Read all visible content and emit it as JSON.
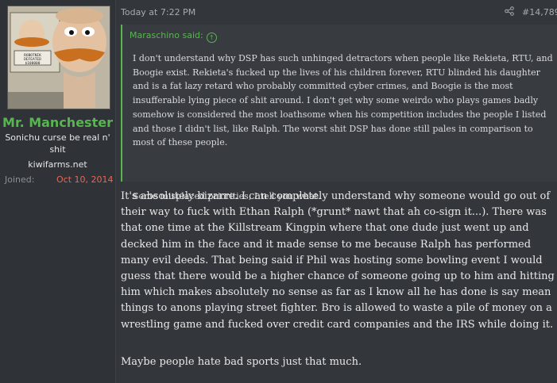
{
  "user": {
    "name": "Mr. Manchester",
    "title": "Sonichu curse be real n' shit",
    "banner": "kiwifarms.net",
    "joined_label": "Joined:",
    "joined_date": "Oct 10, 2014",
    "avatar_caption": "ROBOTNIK DEFEATED $100000"
  },
  "post": {
    "timestamp": "Today at 7:22 PM",
    "number": "#14,789",
    "quote": {
      "author": "Maraschino said:",
      "body": "I don't understand why DSP has such unhinged detractors when people like Rekieta, RTU, and Boogie exist. Rekieta's fucked up the lives of his children forever, RTU blinded his daughter and is a fat lazy retard who probably committed cyber crimes, and Boogie is the most insufferable lying piece of shit around. I don't get why some weirdo who plays games badly somehow is considered the most loathsome when his competition includes the people I listed and those I didn't list, like Ralph. The worst shit DSP has done still pales in comparison to most of these people.",
      "tail": "Some misplaced priorities, I tell you what."
    },
    "body": "It's absolutely bizarre. I can completely understand why someone would go out of their way to fuck with Ethan Ralph (*grunt* nawt that ah co-sign it...). There was that one time at the Killstream Kingpin where that one dude just went up and decked him in the face and it made sense to me because Ralph has performed many evil deeds. That being said if Phil was hosting some bowling event I would guess that there would be a higher chance of someone going up to him and hitting him which makes absolutely no sense as far as I know all he has done is say mean things to anons playing street fighter. Bro is allowed to waste a pile of money on a wrestling game and fucked over credit card companies and the IRS while doing it.",
    "closing": "Maybe people hate bad sports just that much."
  },
  "colors": {
    "username": "#58b550",
    "joined_date": "#e06a5a",
    "quote_border": "#58b550",
    "background": "#33363b"
  },
  "icons": {
    "share": "share-icon",
    "quote_jump": "arrow-up-circle-icon"
  }
}
